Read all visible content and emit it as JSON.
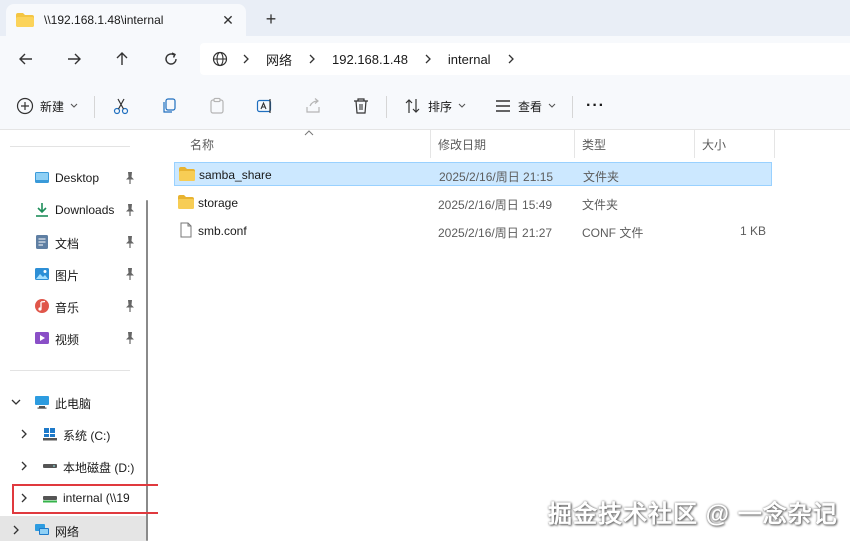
{
  "tab": {
    "title": "\\\\192.168.1.48\\internal",
    "close_glyph": "✕",
    "new_glyph": "+"
  },
  "address": {
    "crumbs": [
      "网络",
      "192.168.1.48",
      "internal"
    ]
  },
  "toolbar": {
    "new_label": "新建",
    "sort_label": "排序",
    "view_label": "查看",
    "more_glyph": "···"
  },
  "sidebar": {
    "quick": [
      {
        "label": "Desktop"
      },
      {
        "label": "Downloads"
      },
      {
        "label": "文档"
      },
      {
        "label": "图片"
      },
      {
        "label": "音乐"
      },
      {
        "label": "视频"
      }
    ],
    "this_pc": "此电脑",
    "drives": [
      {
        "label": "系统 (C:)"
      },
      {
        "label": "本地磁盘 (D:)"
      },
      {
        "label": "internal (\\\\19"
      }
    ],
    "network": "网络"
  },
  "columns": {
    "name": "名称",
    "date": "修改日期",
    "type": "类型",
    "size": "大小"
  },
  "files": [
    {
      "name": "samba_share",
      "date": "2025/2/16/周日 21:15",
      "type": "文件夹",
      "size": ""
    },
    {
      "name": "storage",
      "date": "2025/2/16/周日 15:49",
      "type": "文件夹",
      "size": ""
    },
    {
      "name": "smb.conf",
      "date": "2025/2/16/周日 21:27",
      "type": "CONF 文件",
      "size": "1 KB"
    }
  ],
  "watermark": "掘金技术社区 @ 一念杂记",
  "colors": {
    "folder": "#f4c542",
    "selection": "#cce8ff",
    "highlight": "#e0393e"
  }
}
